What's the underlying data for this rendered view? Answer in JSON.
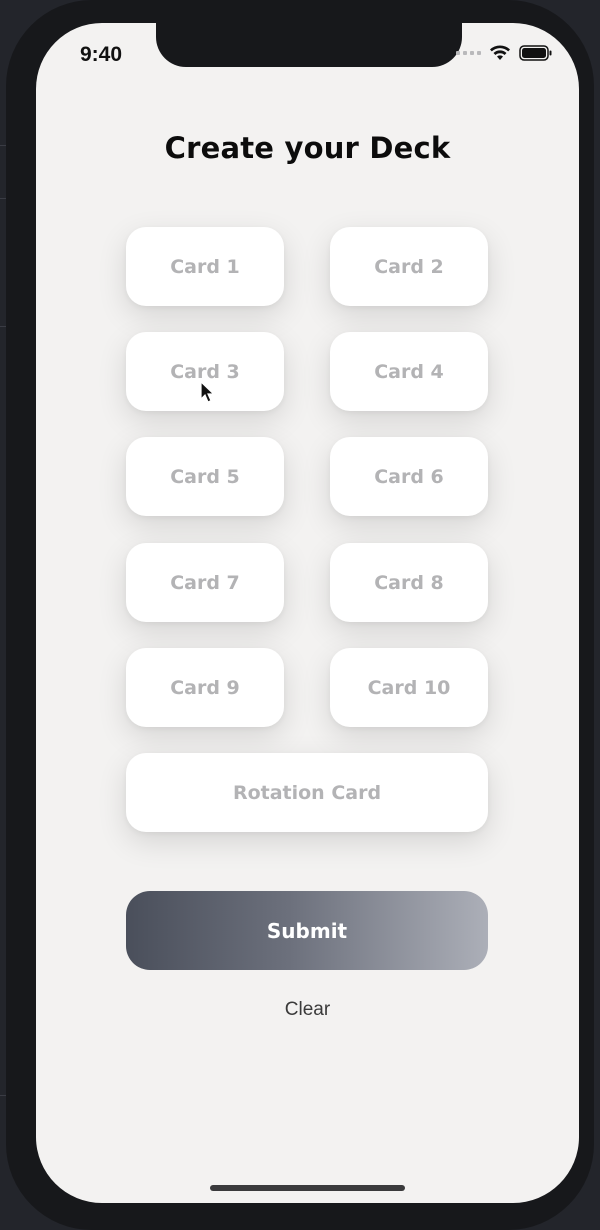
{
  "status_bar": {
    "time": "9:40",
    "icons": [
      "signal-dots-icon",
      "wifi-icon",
      "battery-icon"
    ]
  },
  "page": {
    "title": "Create your Deck"
  },
  "cards": [
    {
      "label": "Card 1"
    },
    {
      "label": "Card 2"
    },
    {
      "label": "Card 3"
    },
    {
      "label": "Card 4"
    },
    {
      "label": "Card 5"
    },
    {
      "label": "Card 6"
    },
    {
      "label": "Card 7"
    },
    {
      "label": "Card 8"
    },
    {
      "label": "Card 9"
    },
    {
      "label": "Card 10"
    }
  ],
  "rotation_card": {
    "label": "Rotation Card"
  },
  "actions": {
    "submit_label": "Submit",
    "clear_label": "Clear"
  },
  "colors": {
    "screen_background": "#f3f2f1",
    "card_text": "#b3b3b5",
    "submit_gradient_start": "#4a4f5b",
    "submit_gradient_end": "#acafb8"
  }
}
